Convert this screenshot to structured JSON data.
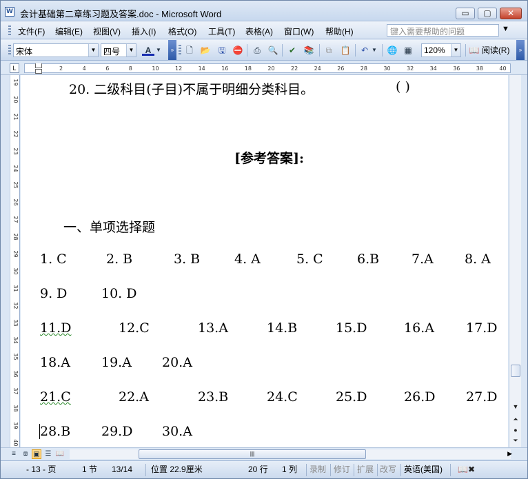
{
  "window": {
    "title": "会计基础第二章练习题及答案.doc - Microsoft Word",
    "app_icon": "word-icon",
    "controls": {
      "minimize": "▭",
      "maximize": "▢",
      "close": "✕"
    }
  },
  "menu": {
    "items": [
      "文件(F)",
      "编辑(E)",
      "视图(V)",
      "插入(I)",
      "格式(O)",
      "工具(T)",
      "表格(A)",
      "窗口(W)",
      "帮助(H)"
    ],
    "help_placeholder": "键入需要帮助的问题"
  },
  "toolbar": {
    "font_name": "宋体",
    "font_size": "四号",
    "font_color_label": "A",
    "zoom": "120%",
    "read_label": "阅读(R)",
    "icons": [
      "new-doc-icon",
      "open-icon",
      "save-icon",
      "permission-icon",
      "print-icon",
      "print-preview-icon",
      "spelling-icon",
      "research-icon",
      "copy-icon",
      "paste-icon",
      "undo-icon",
      "hyperlink-icon",
      "table-icon"
    ]
  },
  "ruler": {
    "corner": "L",
    "h_ticks": [
      "2",
      "4",
      "6",
      "8",
      "10",
      "12",
      "14",
      "16",
      "18",
      "20",
      "22",
      "24",
      "26",
      "28",
      "30",
      "32",
      "34",
      "36",
      "38",
      "40"
    ],
    "v_ticks": [
      "19",
      "20",
      "21",
      "22",
      "23",
      "24",
      "25",
      "26",
      "27",
      "28",
      "29",
      "30",
      "31",
      "32",
      "33",
      "34",
      "35",
      "36",
      "37",
      "38",
      "39",
      "40"
    ]
  },
  "document": {
    "question20": "20. 二级科目(子目)不属于明细分类科目。",
    "question20_paren": "(    )",
    "answers_heading": "[参考答案]:",
    "section1_heading": "一、单项选择题",
    "answer_rows": [
      [
        "1. C",
        "2. B",
        "3. B",
        "4. A",
        "5. C",
        "6.B",
        "7.A",
        "8. A"
      ],
      [
        "9. D",
        "10. D"
      ],
      [
        "11.D",
        "12.C",
        "13.A",
        "14.B",
        "15.D",
        "16.A",
        "17.D"
      ],
      [
        "18.A",
        "19.A",
        "20.A"
      ],
      [
        "21.C",
        "22.A",
        "23.B",
        "24.C",
        "25.D",
        "26.D",
        "27.D"
      ],
      [
        "28.B",
        "29.D",
        "30.A"
      ]
    ]
  },
  "status": {
    "page": "- 13 - 页",
    "section": "1 节",
    "page_of": "13/14",
    "position": "位置 22.9厘米",
    "line": "20 行",
    "column": "1 列",
    "rec": "录制",
    "trk": "修订",
    "ext": "扩展",
    "ovr": "改写",
    "language": "英语(美国)"
  }
}
